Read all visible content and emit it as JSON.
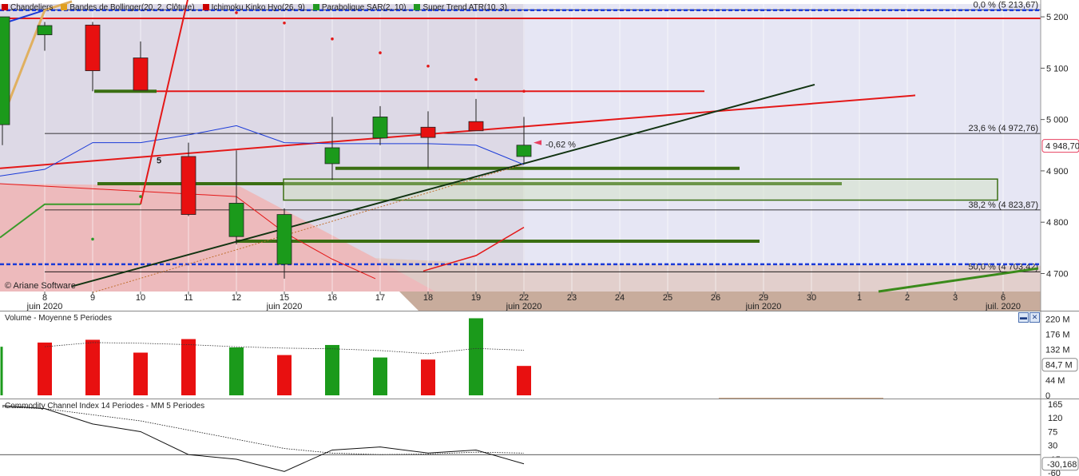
{
  "legend": [
    {
      "label": "Chandeliers",
      "color": "#cc0000"
    },
    {
      "label": "Bandes de Bollinger(20, 2, Clôture)",
      "color": "#e0a020"
    },
    {
      "label": "Ichimoku Kinko Hyo(26, 9)",
      "color": "#cc0000"
    },
    {
      "label": "Parabolique SAR(2, 10)",
      "color": "#229922"
    },
    {
      "label": "Super Trend ATR(10, 3)",
      "color": "#229922"
    }
  ],
  "copyright": "© Ariane Software",
  "wave_label": "5",
  "last_change": "-0,62 %",
  "volume_title": "Volume - Moyenne 5 Periodes",
  "cci_title": "Commodity Channel Index 14 Periodes - MM 5 Periodes",
  "colors": {
    "up": "#1b9a1b",
    "down": "#e81010",
    "fib": "#000000",
    "blue": "#1a3ad8"
  },
  "chart_data": [
    {
      "type": "candlestick",
      "title": "",
      "x_ticks": [
        "8",
        "9",
        "10",
        "11",
        "12",
        "15",
        "16",
        "17",
        "18",
        "19",
        "22",
        "23",
        "24",
        "25",
        "26",
        "29",
        "30",
        "1",
        "2",
        "3",
        "6"
      ],
      "month_labels": [
        {
          "at": "8",
          "text": "juin 2020"
        },
        {
          "at": "15",
          "text": "juin 2020"
        },
        {
          "at": "22",
          "text": "juin 2020"
        },
        {
          "at": "29",
          "text": "juin 2020"
        },
        {
          "at": "6",
          "text": "juil. 2020"
        }
      ],
      "y_ticks": [
        {
          "value": 5200,
          "label": "5 200"
        },
        {
          "value": 5100,
          "label": "5 100"
        },
        {
          "value": 5000,
          "label": "5 000"
        },
        {
          "value": 4900,
          "label": "4 900"
        },
        {
          "value": 4800,
          "label": "4 800"
        },
        {
          "value": 4700,
          "label": "4 700"
        }
      ],
      "ylim": [
        4665,
        5225
      ],
      "candles": [
        {
          "date": "5",
          "open": 4990,
          "high": 5200,
          "low": 4950,
          "close": 5200
        },
        {
          "date": "8",
          "open": 5165,
          "high": 5190,
          "low": 5134,
          "close": 5183
        },
        {
          "date": "9",
          "open": 5184,
          "high": 5190,
          "low": 5055,
          "close": 5095
        },
        {
          "date": "10",
          "open": 5120,
          "high": 5152,
          "low": 5057,
          "close": 5057
        },
        {
          "date": "11",
          "open": 4928,
          "high": 4955,
          "low": 4812,
          "close": 4815
        },
        {
          "date": "12",
          "open": 4772,
          "high": 4940,
          "low": 4757,
          "close": 4837
        },
        {
          "date": "15",
          "open": 4718,
          "high": 4827,
          "low": 4690,
          "close": 4815
        },
        {
          "date": "16",
          "open": 4914,
          "high": 5005,
          "low": 4882,
          "close": 4945
        },
        {
          "date": "17",
          "open": 4964,
          "high": 5026,
          "low": 4950,
          "close": 5005
        },
        {
          "date": "18",
          "open": 4985,
          "high": 5016,
          "low": 4905,
          "close": 4965
        },
        {
          "date": "19",
          "open": 4996,
          "high": 5040,
          "low": 4980,
          "close": 4978
        },
        {
          "date": "22",
          "open": 4928,
          "high": 5005,
          "low": 4915,
          "close": 4950
        }
      ],
      "sar": [
        {
          "date": "12",
          "value": 5208
        },
        {
          "date": "15",
          "value": 5188
        },
        {
          "date": "16",
          "value": 5157
        },
        {
          "date": "17",
          "value": 5130
        },
        {
          "date": "18",
          "value": 5104
        },
        {
          "date": "19",
          "value": 5078
        },
        {
          "date": "22",
          "value": 5055
        },
        {
          "date": "9",
          "value": 4767
        },
        {
          "date": "10",
          "value": 4850
        }
      ],
      "fibonacci": [
        {
          "label": "0,0 % (5 213,67)",
          "value": 5213.67
        },
        {
          "label": "23,6 % (4 972,76)",
          "value": 4972.76
        },
        {
          "label": "38,2 % (4 823,87)",
          "value": 4823.87
        },
        {
          "label": "50,0 % (4 703,42)",
          "value": 4703.42
        }
      ],
      "last_price": {
        "label": "4 948,70",
        "value": 4948.7
      },
      "horizontal_levels": [
        5197,
        5055,
        4905,
        4875,
        4763
      ],
      "dashed_levels": [
        5213,
        4718
      ]
    },
    {
      "type": "bar",
      "title": "Volume - Moyenne 5 Periodes",
      "categories": [
        "8",
        "9",
        "10",
        "11",
        "12",
        "15",
        "16",
        "17",
        "18",
        "19",
        "22"
      ],
      "values": [
        152,
        160,
        123,
        162,
        138,
        116,
        145,
        109,
        103,
        222,
        84.7
      ],
      "colors": [
        "down",
        "down",
        "down",
        "down",
        "up",
        "down",
        "up",
        "up",
        "down",
        "up",
        "down"
      ],
      "moving_average": [
        140,
        152,
        150,
        146,
        140,
        136,
        134,
        129,
        120,
        135,
        130
      ],
      "y_ticks": [
        {
          "value": 220,
          "label": "220 M"
        },
        {
          "value": 176,
          "label": "176 M"
        },
        {
          "value": 132,
          "label": "132 M"
        },
        {
          "value": 88,
          "label": "84,7 M"
        },
        {
          "value": 44,
          "label": "44 M"
        },
        {
          "value": 0,
          "label": "0"
        }
      ],
      "ylim": [
        0,
        230
      ]
    },
    {
      "type": "line",
      "title": "Commodity Channel Index 14 Periodes - MM 5 Periodes",
      "categories": [
        "5",
        "8",
        "9",
        "10",
        "11",
        "12",
        "15",
        "16",
        "17",
        "18",
        "19",
        "22"
      ],
      "series": [
        {
          "values": [
            160,
            150,
            100,
            75,
            0,
            -15,
            -55,
            15,
            25,
            5,
            15,
            -30.168
          ],
          "style": "solid"
        },
        {
          "values": [
            155,
            150,
            130,
            110,
            80,
            50,
            20,
            5,
            0,
            2,
            8,
            5
          ],
          "style": "dotted"
        }
      ],
      "y_ticks": [
        {
          "value": 165,
          "label": "165"
        },
        {
          "value": 120,
          "label": "120"
        },
        {
          "value": 75,
          "label": "75"
        },
        {
          "value": 30,
          "label": "30"
        },
        {
          "value": -15,
          "label": "-15"
        },
        {
          "value": -30.168,
          "label": "-30,168"
        },
        {
          "value": -60,
          "label": "-60"
        }
      ],
      "ylim": [
        -62,
        170
      ]
    }
  ]
}
